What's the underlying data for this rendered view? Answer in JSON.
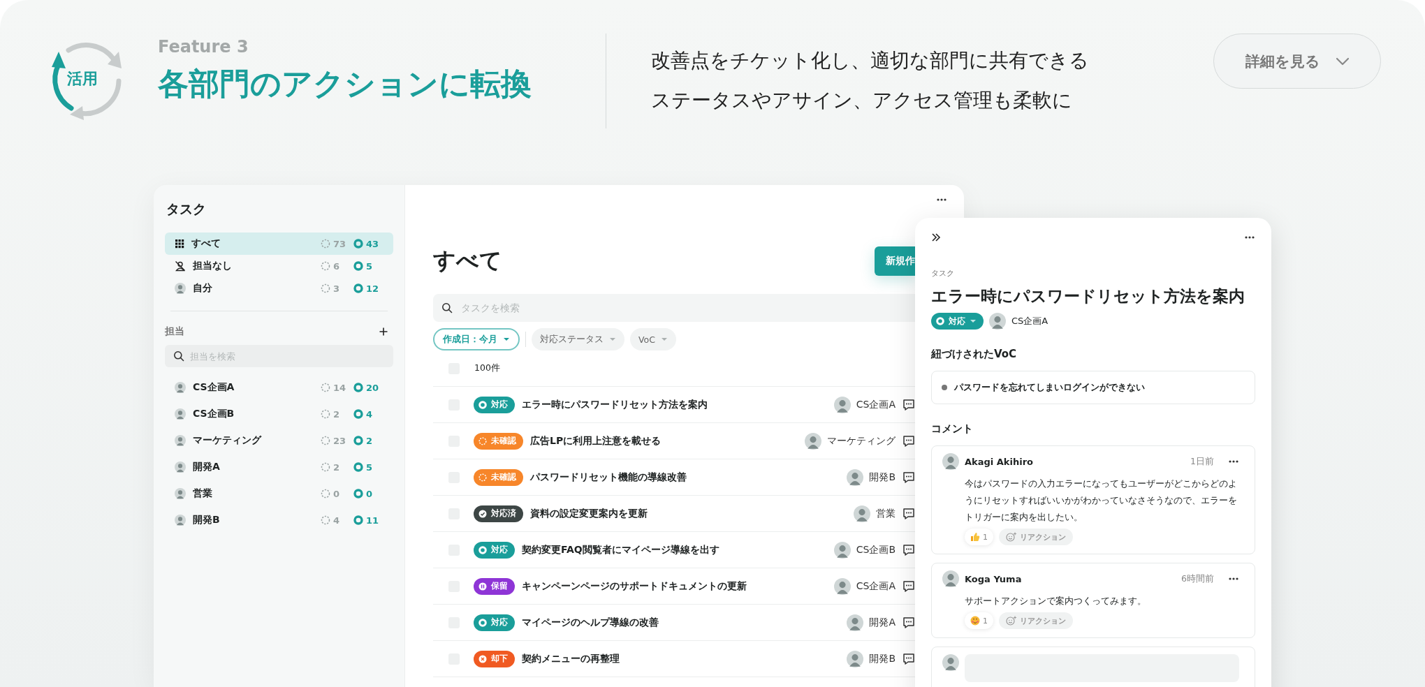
{
  "header": {
    "icon_label": "活用",
    "eyebrow": "Feature 3",
    "title": "各部門のアクションに転換",
    "description": [
      "改善点をチケット化し、適切な部門に共有できる",
      "ステータスやアサイン、アクセス管理も柔軟に"
    ],
    "details_button": "詳細を見る"
  },
  "sidebar": {
    "title": "タスク",
    "views": [
      {
        "kind": "all",
        "label": "すべて",
        "open": "73",
        "active": "43",
        "selected": true
      },
      {
        "kind": "unassigned",
        "label": "担当なし",
        "open": "6",
        "active": "5",
        "selected": false
      },
      {
        "kind": "me",
        "label": "自分",
        "open": "3",
        "active": "12",
        "selected": false
      }
    ],
    "assignee_heading": "担当",
    "assignee_search": {
      "placeholder": "担当を検索"
    },
    "assignees": [
      {
        "label": "CS企画A",
        "open": "14",
        "active": "20"
      },
      {
        "label": "CS企画B",
        "open": "2",
        "active": "4"
      },
      {
        "label": "マーケティング",
        "open": "23",
        "active": "2"
      },
      {
        "label": "開発A",
        "open": "2",
        "active": "5"
      },
      {
        "label": "営業",
        "open": "0",
        "active": "0"
      },
      {
        "label": "開発B",
        "open": "4",
        "active": "11"
      }
    ]
  },
  "main": {
    "title": "すべて",
    "new_button": "新規作",
    "search": {
      "placeholder": "タスクを検索"
    },
    "filters": [
      {
        "label": "作成日：今月",
        "selected": true
      },
      {
        "label": "対応ステータス",
        "selected": false
      },
      {
        "label": "VoC",
        "selected": false
      }
    ],
    "select_all_checked": false,
    "count": "100件",
    "rows": [
      {
        "status": {
          "kind": "active",
          "label": "対応"
        },
        "title": "エラー時にパスワードリセット方法を案内",
        "assignee": "CS企画A",
        "checked": false
      },
      {
        "status": {
          "kind": "unconfirmed",
          "label": "未確認"
        },
        "title": "広告LPに利用上注意を載せる",
        "assignee": "マーケティング",
        "checked": false
      },
      {
        "status": {
          "kind": "unconfirmed",
          "label": "未確認"
        },
        "title": "パスワードリセット機能の導線改善",
        "assignee": "開発B",
        "checked": false
      },
      {
        "status": {
          "kind": "done",
          "label": "対応済"
        },
        "title": "資料の設定変更案内を更新",
        "assignee": "営業",
        "checked": false
      },
      {
        "status": {
          "kind": "active",
          "label": "対応"
        },
        "title": "契約変更FAQ閲覧者にマイページ導線を出す",
        "assignee": "CS企画B",
        "checked": false
      },
      {
        "status": {
          "kind": "hold",
          "label": "保留"
        },
        "title": "キャンペーンページのサポートドキュメントの更新",
        "assignee": "CS企画A",
        "checked": false
      },
      {
        "status": {
          "kind": "active",
          "label": "対応"
        },
        "title": "マイページのヘルプ導線の改善",
        "assignee": "開発A",
        "checked": false
      },
      {
        "status": {
          "kind": "rejected",
          "label": "却下"
        },
        "title": "契約メニューの再整理",
        "assignee": "開発B",
        "checked": false
      }
    ]
  },
  "detail": {
    "eyebrow": "タスク",
    "title": "エラー時にパスワードリセット方法を案内",
    "status": {
      "kind": "active",
      "label": "対応"
    },
    "assignee": "CS企画A",
    "voc_heading": "紐づけされたVoC",
    "voc_items": [
      "パスワードを忘れてしまいログインができない"
    ],
    "comments_heading": "コメント",
    "comments": [
      {
        "author": "Akagi Akihiro",
        "time": "1日前",
        "body": "今はパスワードの入力エラーになってもユーザーがどこからどのようにリセットすればいいかがわかっていなさそうなので、エラーをトリガーに案内を出したい。",
        "reaction": {
          "kind": "thumbs-up",
          "count": "1"
        },
        "reaction_button": "リアクション"
      },
      {
        "author": "Koga Yuma",
        "time": "6時間前",
        "body": "サポートアクションで案内つくってみます。",
        "reaction": {
          "kind": "smiling-face",
          "count": "1"
        },
        "reaction_button": "リアクション"
      }
    ]
  }
}
